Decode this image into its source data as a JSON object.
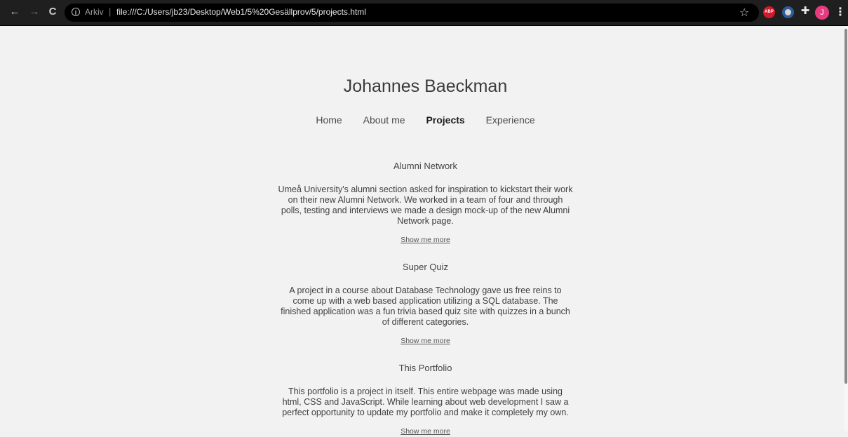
{
  "browser": {
    "site_info": "Arkiv",
    "url": "file:///C:/Users/jb23/Desktop/Web1/5%20Gesällprov/5/projects.html",
    "extension_abp": "ABP",
    "profile_initial": "J",
    "icons": {
      "back": "←",
      "forward": "→",
      "reload": "C",
      "info": "i",
      "star": "☆",
      "puzzle": "✚",
      "menu": "⋮"
    }
  },
  "header": {
    "title": "Johannes Baeckman"
  },
  "nav": {
    "items": [
      {
        "label": "Home"
      },
      {
        "label": "About me"
      },
      {
        "label": "Projects"
      },
      {
        "label": "Experience"
      }
    ]
  },
  "projects": [
    {
      "title": "Alumni Network",
      "description": "Umeå University's alumni section asked for inspiration to kickstart their work on their new Alumni Network. We worked in a team of four and through polls, testing and interviews we made a design mock-up of the new Alumni Network page.",
      "link": "Show me more"
    },
    {
      "title": "Super Quiz",
      "description": "A project in a course about Database Technology gave us free reins to come up with a web based application utilizing a SQL database. The finished application was a fun trivia based quiz site with quizzes in a bunch of different categories.",
      "link": "Show me more"
    },
    {
      "title": "This Portfolio",
      "description": "This portfolio is a project in itself. This entire webpage was made using html, CSS and JavaScript. While learning about web development I saw a perfect opportunity to update my portfolio and make it completely my own.",
      "link": "Show me more"
    }
  ]
}
